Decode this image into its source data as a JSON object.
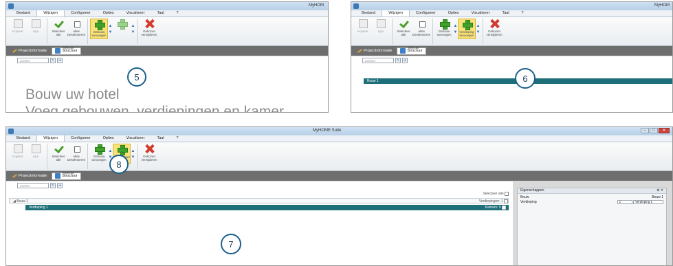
{
  "app_title": "MyHOME Suite",
  "app_title_short": "MyHOM",
  "menu": [
    "Bestand",
    "Wijzigen",
    "Configureer",
    "Opties",
    "Visualiseer",
    "Taal",
    "?"
  ],
  "ribbon": {
    "kopieer": "Kopieer",
    "lijm": "Lijm",
    "selecteer_alle": "Selecteer alle",
    "alles_deselecteren": "Alles Deselecteren",
    "selectie_group": "Selectie",
    "gebouw_toevoegen": "Gebouw toevoegen",
    "verdieping_toevoegen": "Verdieping toevoegen",
    "voeg_kamer": "Voeg kamer",
    "gekozen_verwijderen": "Gekozen verwijderen"
  },
  "tabs": {
    "project_info": "Projectinformatie",
    "structuur": "Structuur"
  },
  "search_placeholder": "Zoeken",
  "panel1": {
    "hero_line1": "Bouw uw hotel",
    "hero_line2": "Voeg gebouwen, verdiepingen en kamer"
  },
  "tree": {
    "bouw": "Bouw 1",
    "verdieping": "Verdieping 1",
    "selecteer_alle": "Selecteer alle",
    "verdiepingen_count": "Verdiepingen: 1",
    "kamers_count": "Kamers: 0"
  },
  "properties": {
    "header": "Eigenschappen",
    "row1_label": "Bouw",
    "row1_value": "Bouw 1",
    "row2_label": "Verdieping",
    "row2_select": "1",
    "row2_value": "Verdieping 1"
  },
  "callouts": {
    "c5": "5",
    "c6": "6",
    "c7": "7",
    "c8": "8"
  },
  "colors": {
    "selection_bar": "#1f6f7b",
    "highlight_button": "#f8e27a",
    "tab_strip": "#6e6e6e"
  }
}
